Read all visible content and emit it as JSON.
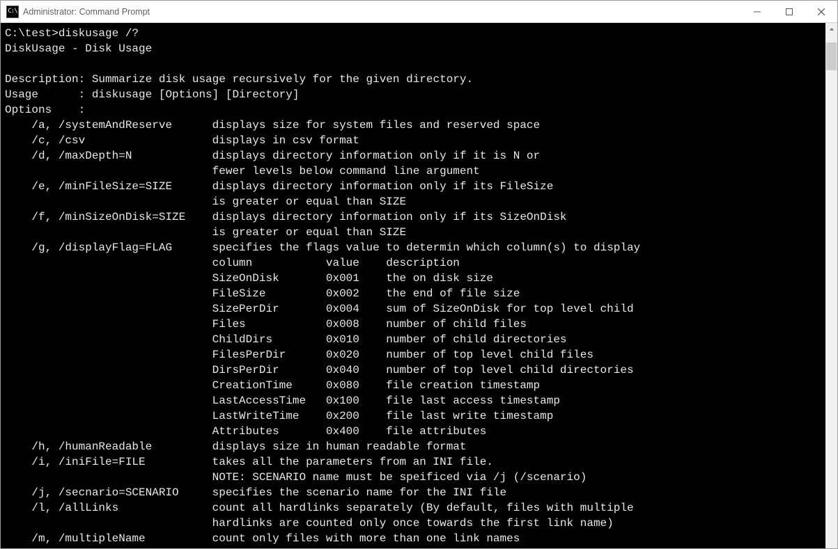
{
  "titlebar": {
    "icon_text": "C:\\",
    "title": "Administrator: Command Prompt"
  },
  "terminal": {
    "prompt": "C:\\test>",
    "command": "diskusage /?",
    "header": "DiskUsage - Disk Usage",
    "description_label": "Description:",
    "description": "Summarize disk usage recursively for the given directory.",
    "usage_label": "Usage      :",
    "usage": "diskusage [Options] [Directory]",
    "options_label": "Options    :"
  },
  "options": [
    {
      "flag": "/a, /systemAndReserve",
      "desc": [
        "displays size for system files and reserved space"
      ]
    },
    {
      "flag": "/c, /csv",
      "desc": [
        "displays in csv format"
      ]
    },
    {
      "flag": "/d, /maxDepth=N",
      "desc": [
        "displays directory information only if it is N or",
        "fewer levels below command line argument"
      ]
    },
    {
      "flag": "/e, /minFileSize=SIZE",
      "desc": [
        "displays directory information only if its FileSize",
        "is greater or equal than SIZE"
      ]
    },
    {
      "flag": "/f, /minSizeOnDisk=SIZE",
      "desc": [
        "displays directory information only if its SizeOnDisk",
        "is greater or equal than SIZE"
      ]
    },
    {
      "flag": "/g, /displayFlag=FLAG",
      "desc": [
        "specifies the flags value to determin which column(s) to display"
      ]
    }
  ],
  "g_table": {
    "header": {
      "col1": "column",
      "col2": "value",
      "col3": "description"
    },
    "rows": [
      {
        "col1": "SizeOnDisk",
        "col2": "0x001",
        "col3": "the on disk size"
      },
      {
        "col1": "FileSize",
        "col2": "0x002",
        "col3": "the end of file size"
      },
      {
        "col1": "SizePerDir",
        "col2": "0x004",
        "col3": "sum of SizeOnDisk for top level child"
      },
      {
        "col1": "Files",
        "col2": "0x008",
        "col3": "number of child files"
      },
      {
        "col1": "ChildDirs",
        "col2": "0x010",
        "col3": "number of child directories"
      },
      {
        "col1": "FilesPerDir",
        "col2": "0x020",
        "col3": "number of top level child files"
      },
      {
        "col1": "DirsPerDir",
        "col2": "0x040",
        "col3": "number of top level child directories"
      },
      {
        "col1": "CreationTime",
        "col2": "0x080",
        "col3": "file creation timestamp"
      },
      {
        "col1": "LastAccessTime",
        "col2": "0x100",
        "col3": "file last access timestamp"
      },
      {
        "col1": "LastWriteTime",
        "col2": "0x200",
        "col3": "file last write timestamp"
      },
      {
        "col1": "Attributes",
        "col2": "0x400",
        "col3": "file attributes"
      }
    ]
  },
  "options2": [
    {
      "flag": "/h, /humanReadable",
      "desc": [
        "displays size in human readable format"
      ]
    },
    {
      "flag": "/i, /iniFile=FILE",
      "desc": [
        "takes all the parameters from an INI file.",
        "NOTE: SCENARIO name must be speificed via /j (/scenario)"
      ]
    },
    {
      "flag": "/j, /secnario=SCENARIO",
      "desc": [
        "specifies the scenario name for the INI file"
      ]
    },
    {
      "flag": "/l, /allLinks",
      "desc": [
        "count all hardlinks separately (By default, files with multiple",
        "hardlinks are counted only once towards the first link name)"
      ]
    },
    {
      "flag": "/m, /multipleName",
      "desc": [
        "count only files with more than one link names"
      ]
    }
  ]
}
